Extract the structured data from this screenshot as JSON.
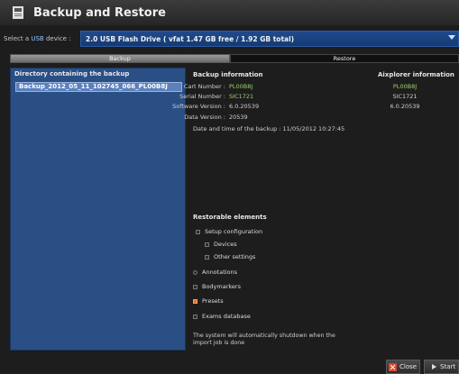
{
  "window": {
    "title": "Backup and Restore"
  },
  "device": {
    "label_prefix": "Select a ",
    "label_usb": "USB",
    "label_suffix": " device :",
    "selected": "2.0 USB Flash Drive ( vfat 1.47 GB free / 1.92 GB total)"
  },
  "tabs": {
    "backup": "Backup",
    "restore": "Restore",
    "active": "Restore"
  },
  "directory": {
    "header": "Directory containing the backup",
    "items": [
      "Backup_2012_05_11_102745_066_PL00B8J"
    ]
  },
  "backup_info": {
    "title": "Backup information",
    "cart_label": "Cart Number :",
    "cart_value": "PL00B8J",
    "serial_label": "Serial Number :",
    "serial_value": "SIC1721",
    "software_label": "Software Version :",
    "software_value": "6.0.20539",
    "data_label": "Data Version :",
    "data_value": "20539",
    "date_line": "Date and time of the backup : 11/05/2012 10:27:45"
  },
  "aixplorer_info": {
    "title": "Aixplorer information",
    "cart": "PL00B8J",
    "serial": "SIC1721",
    "software": "6.0.20539"
  },
  "restorable": {
    "title": "Restorable elements",
    "setup": "Setup configuration",
    "devices": "Devices",
    "other": "Other settings",
    "annotations": "Annotations",
    "bodymarkers": "Bodymarkers",
    "presets": "Presets",
    "exams": "Exams database",
    "presets_checked": true
  },
  "note": "The system will automatically shutdown when the import job is done",
  "buttons": {
    "close": "Close",
    "start": "Start"
  },
  "colors": {
    "accent_blue": "#2a4f85",
    "selection": "#5c80bd",
    "green_value": "#9ed26a",
    "checked_orange": "#e07a2e"
  }
}
